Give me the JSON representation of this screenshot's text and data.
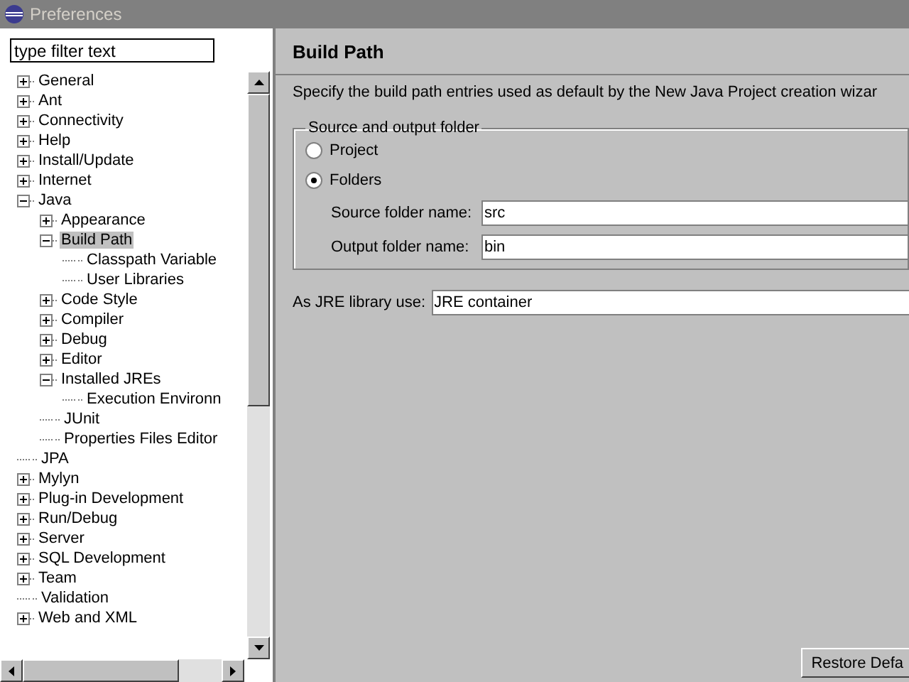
{
  "window": {
    "title": "Preferences"
  },
  "filter": {
    "value": "type filter text"
  },
  "tree": [
    {
      "label": "General",
      "expanded": false,
      "selected": false,
      "has_children": true
    },
    {
      "label": "Ant",
      "expanded": false,
      "selected": false,
      "has_children": true
    },
    {
      "label": "Connectivity",
      "expanded": false,
      "selected": false,
      "has_children": true
    },
    {
      "label": "Help",
      "expanded": false,
      "selected": false,
      "has_children": true
    },
    {
      "label": "Install/Update",
      "expanded": false,
      "selected": false,
      "has_children": true
    },
    {
      "label": "Internet",
      "expanded": false,
      "selected": false,
      "has_children": true
    },
    {
      "label": "Java",
      "expanded": true,
      "selected": false,
      "has_children": true,
      "children": [
        {
          "label": "Appearance",
          "expanded": false,
          "selected": false,
          "has_children": true
        },
        {
          "label": "Build Path",
          "expanded": true,
          "selected": true,
          "has_children": true,
          "children": [
            {
              "label": "Classpath Variable",
              "selected": false,
              "has_children": false
            },
            {
              "label": "User Libraries",
              "selected": false,
              "has_children": false
            }
          ]
        },
        {
          "label": "Code Style",
          "expanded": false,
          "selected": false,
          "has_children": true
        },
        {
          "label": "Compiler",
          "expanded": false,
          "selected": false,
          "has_children": true
        },
        {
          "label": "Debug",
          "expanded": false,
          "selected": false,
          "has_children": true
        },
        {
          "label": "Editor",
          "expanded": false,
          "selected": false,
          "has_children": true
        },
        {
          "label": "Installed JREs",
          "expanded": true,
          "selected": false,
          "has_children": true,
          "children": [
            {
              "label": "Execution Environn",
              "selected": false,
              "has_children": false
            }
          ]
        },
        {
          "label": "JUnit",
          "selected": false,
          "has_children": false
        },
        {
          "label": "Properties Files Editor",
          "selected": false,
          "has_children": false
        }
      ]
    },
    {
      "label": "JPA",
      "selected": false,
      "has_children": false
    },
    {
      "label": "Mylyn",
      "expanded": false,
      "selected": false,
      "has_children": true
    },
    {
      "label": "Plug-in Development",
      "expanded": false,
      "selected": false,
      "has_children": true
    },
    {
      "label": "Run/Debug",
      "expanded": false,
      "selected": false,
      "has_children": true
    },
    {
      "label": "Server",
      "expanded": false,
      "selected": false,
      "has_children": true
    },
    {
      "label": "SQL Development",
      "expanded": false,
      "selected": false,
      "has_children": true
    },
    {
      "label": "Team",
      "expanded": false,
      "selected": false,
      "has_children": true
    },
    {
      "label": "Validation",
      "selected": false,
      "has_children": false
    },
    {
      "label": "Web and XML",
      "expanded": false,
      "selected": false,
      "has_children": true
    }
  ],
  "page": {
    "title": "Build Path",
    "description": "Specify the build path entries used as default by the New Java Project creation wizar",
    "group": {
      "title": "Source and output folder",
      "options": [
        {
          "label": "Project",
          "selected": false
        },
        {
          "label": "Folders",
          "selected": true
        }
      ],
      "fields": [
        {
          "label": "Source folder name:",
          "value": "src"
        },
        {
          "label": "Output folder name:",
          "value": "bin"
        }
      ]
    },
    "jre": {
      "label": "As JRE library use:",
      "value": "JRE container"
    },
    "restore_button": {
      "label": "Restore Defa"
    }
  }
}
